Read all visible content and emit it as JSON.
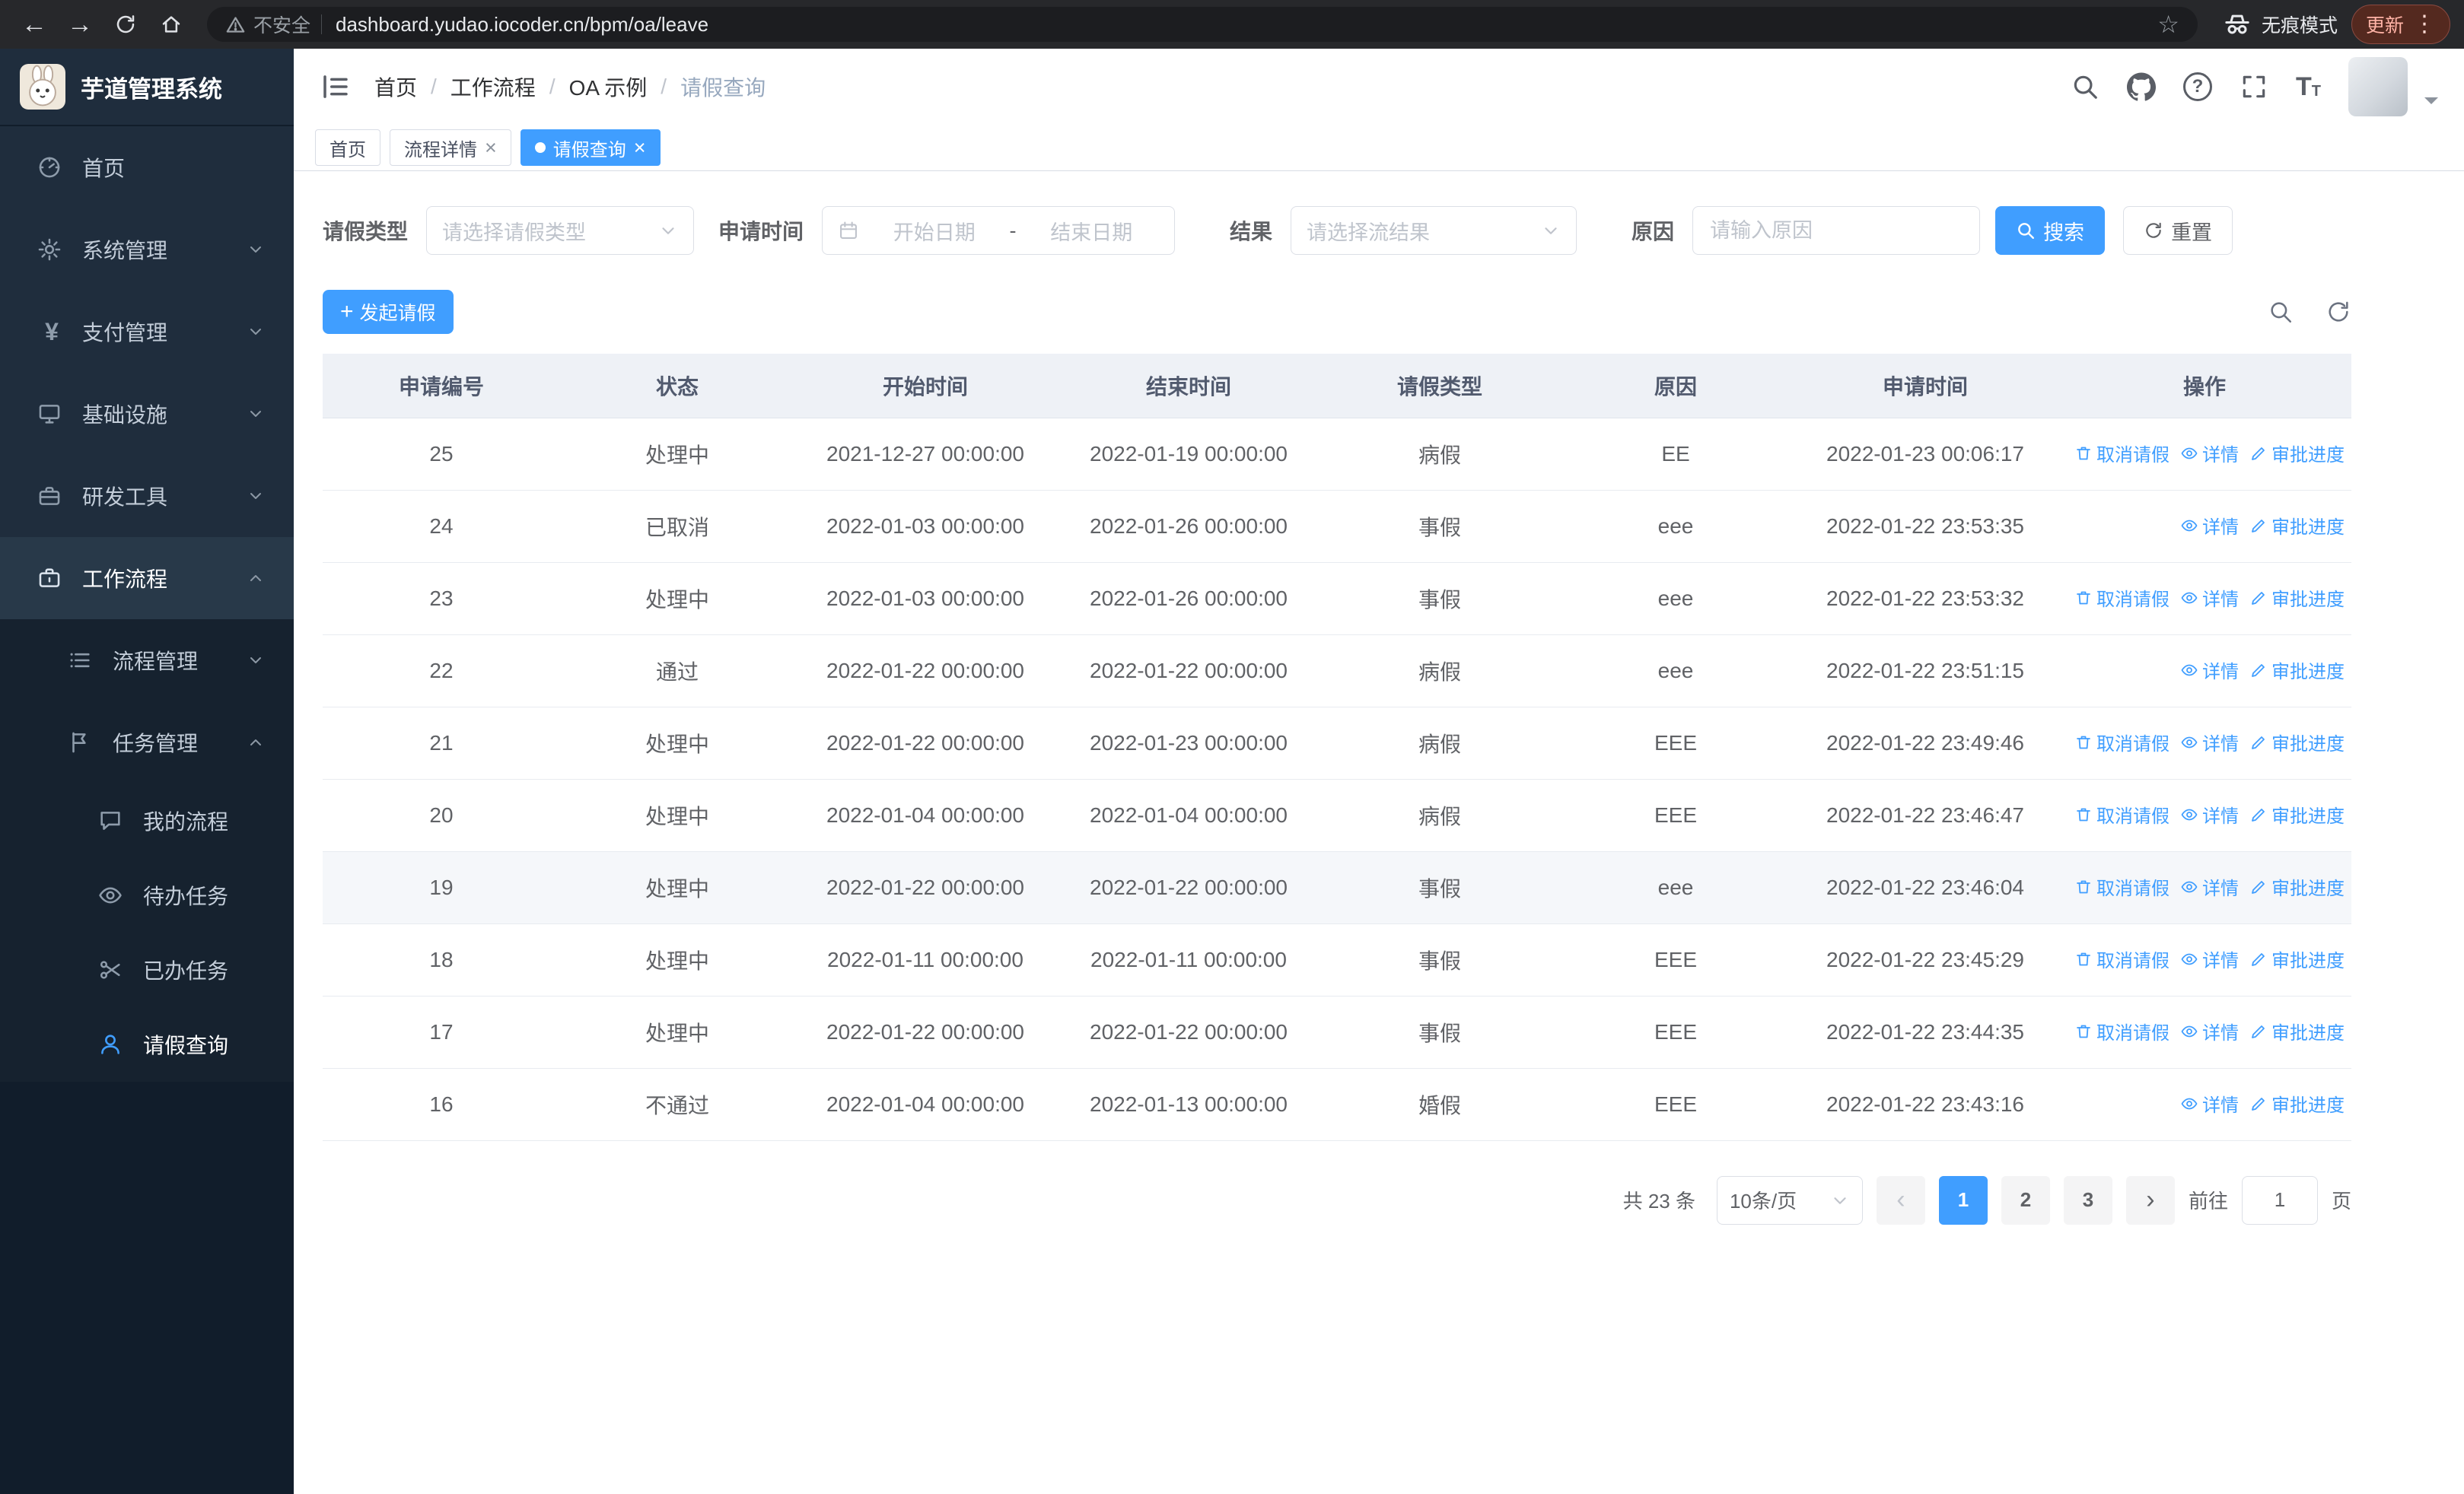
{
  "colors": {
    "primary": "#409eff",
    "sidebar_bg": "#111d2b",
    "menu_bg": "#1f2d3d",
    "submenu_bg": "#16222f",
    "table_header_bg": "#eef1f6"
  },
  "icons": {
    "back": "←",
    "forward": "→",
    "star": "☆",
    "menu_dots": "⋮",
    "close": "×",
    "plus": "+",
    "chevron_left": "‹",
    "chevron_right": "›",
    "font": "T",
    "question": "?"
  },
  "browser": {
    "not_secure": "不安全",
    "url": "dashboard.yudao.iocoder.cn/bpm/oa/leave",
    "incognito": "无痕模式",
    "update": "更新"
  },
  "sidebar": {
    "logo_title": "芋道管理系统",
    "items": [
      {
        "label": "首页"
      },
      {
        "label": "系统管理"
      },
      {
        "label": "支付管理"
      },
      {
        "label": "基础设施"
      },
      {
        "label": "研发工具"
      },
      {
        "label": "工作流程"
      },
      {
        "label": "流程管理"
      },
      {
        "label": "任务管理"
      },
      {
        "label": "我的流程"
      },
      {
        "label": "待办任务"
      },
      {
        "label": "已办任务"
      },
      {
        "label": "请假查询"
      }
    ]
  },
  "header": {
    "breadcrumb": [
      "首页",
      "工作流程",
      "OA 示例",
      "请假查询"
    ]
  },
  "tabs": [
    {
      "label": "首页"
    },
    {
      "label": "流程详情"
    },
    {
      "label": "请假查询"
    }
  ],
  "filters": {
    "leave_type_label": "请假类型",
    "leave_type_placeholder": "请选择请假类型",
    "apply_time_label": "申请时间",
    "start_date_placeholder": "开始日期",
    "range_separator": "-",
    "end_date_placeholder": "结束日期",
    "result_label": "结果",
    "result_placeholder": "请选择流结果",
    "reason_label": "原因",
    "reason_placeholder": "请输入原因",
    "search_label": "搜索",
    "reset_label": "重置"
  },
  "toolbar": {
    "create_label": "发起请假"
  },
  "table": {
    "columns": [
      "申请编号",
      "状态",
      "开始时间",
      "结束时间",
      "请假类型",
      "原因",
      "申请时间",
      "操作"
    ],
    "op_labels": {
      "cancel": "取消请假",
      "detail": "详情",
      "progress": "审批进度"
    },
    "rows": [
      {
        "id": "25",
        "status": "处理中",
        "start": "2021-12-27 00:00:00",
        "end": "2022-01-19 00:00:00",
        "type": "病假",
        "reason": "EE",
        "applied": "2022-01-23 00:06:17",
        "ops": [
          "cancel",
          "detail",
          "progress"
        ]
      },
      {
        "id": "24",
        "status": "已取消",
        "start": "2022-01-03 00:00:00",
        "end": "2022-01-26 00:00:00",
        "type": "事假",
        "reason": "eee",
        "applied": "2022-01-22 23:53:35",
        "ops": [
          "detail",
          "progress"
        ]
      },
      {
        "id": "23",
        "status": "处理中",
        "start": "2022-01-03 00:00:00",
        "end": "2022-01-26 00:00:00",
        "type": "事假",
        "reason": "eee",
        "applied": "2022-01-22 23:53:32",
        "ops": [
          "cancel",
          "detail",
          "progress"
        ]
      },
      {
        "id": "22",
        "status": "通过",
        "start": "2022-01-22 00:00:00",
        "end": "2022-01-22 00:00:00",
        "type": "病假",
        "reason": "eee",
        "applied": "2022-01-22 23:51:15",
        "ops": [
          "detail",
          "progress"
        ]
      },
      {
        "id": "21",
        "status": "处理中",
        "start": "2022-01-22 00:00:00",
        "end": "2022-01-23 00:00:00",
        "type": "病假",
        "reason": "EEE",
        "applied": "2022-01-22 23:49:46",
        "ops": [
          "cancel",
          "detail",
          "progress"
        ]
      },
      {
        "id": "20",
        "status": "处理中",
        "start": "2022-01-04 00:00:00",
        "end": "2022-01-04 00:00:00",
        "type": "病假",
        "reason": "EEE",
        "applied": "2022-01-22 23:46:47",
        "ops": [
          "cancel",
          "detail",
          "progress"
        ]
      },
      {
        "id": "19",
        "status": "处理中",
        "start": "2022-01-22 00:00:00",
        "end": "2022-01-22 00:00:00",
        "type": "事假",
        "reason": "eee",
        "applied": "2022-01-22 23:46:04",
        "ops": [
          "cancel",
          "detail",
          "progress"
        ],
        "highlight": true
      },
      {
        "id": "18",
        "status": "处理中",
        "start": "2022-01-11 00:00:00",
        "end": "2022-01-11 00:00:00",
        "type": "事假",
        "reason": "EEE",
        "applied": "2022-01-22 23:45:29",
        "ops": [
          "cancel",
          "detail",
          "progress"
        ]
      },
      {
        "id": "17",
        "status": "处理中",
        "start": "2022-01-22 00:00:00",
        "end": "2022-01-22 00:00:00",
        "type": "事假",
        "reason": "EEE",
        "applied": "2022-01-22 23:44:35",
        "ops": [
          "cancel",
          "detail",
          "progress"
        ]
      },
      {
        "id": "16",
        "status": "不通过",
        "start": "2022-01-04 00:00:00",
        "end": "2022-01-13 00:00:00",
        "type": "婚假",
        "reason": "EEE",
        "applied": "2022-01-22 23:43:16",
        "ops": [
          "detail",
          "progress"
        ]
      }
    ]
  },
  "pagination": {
    "total": "共 23 条",
    "page_size": "10条/页",
    "pages": [
      "1",
      "2",
      "3"
    ],
    "active_page": "1",
    "goto_label": "前往",
    "goto_value": "1",
    "unit_label": "页"
  }
}
